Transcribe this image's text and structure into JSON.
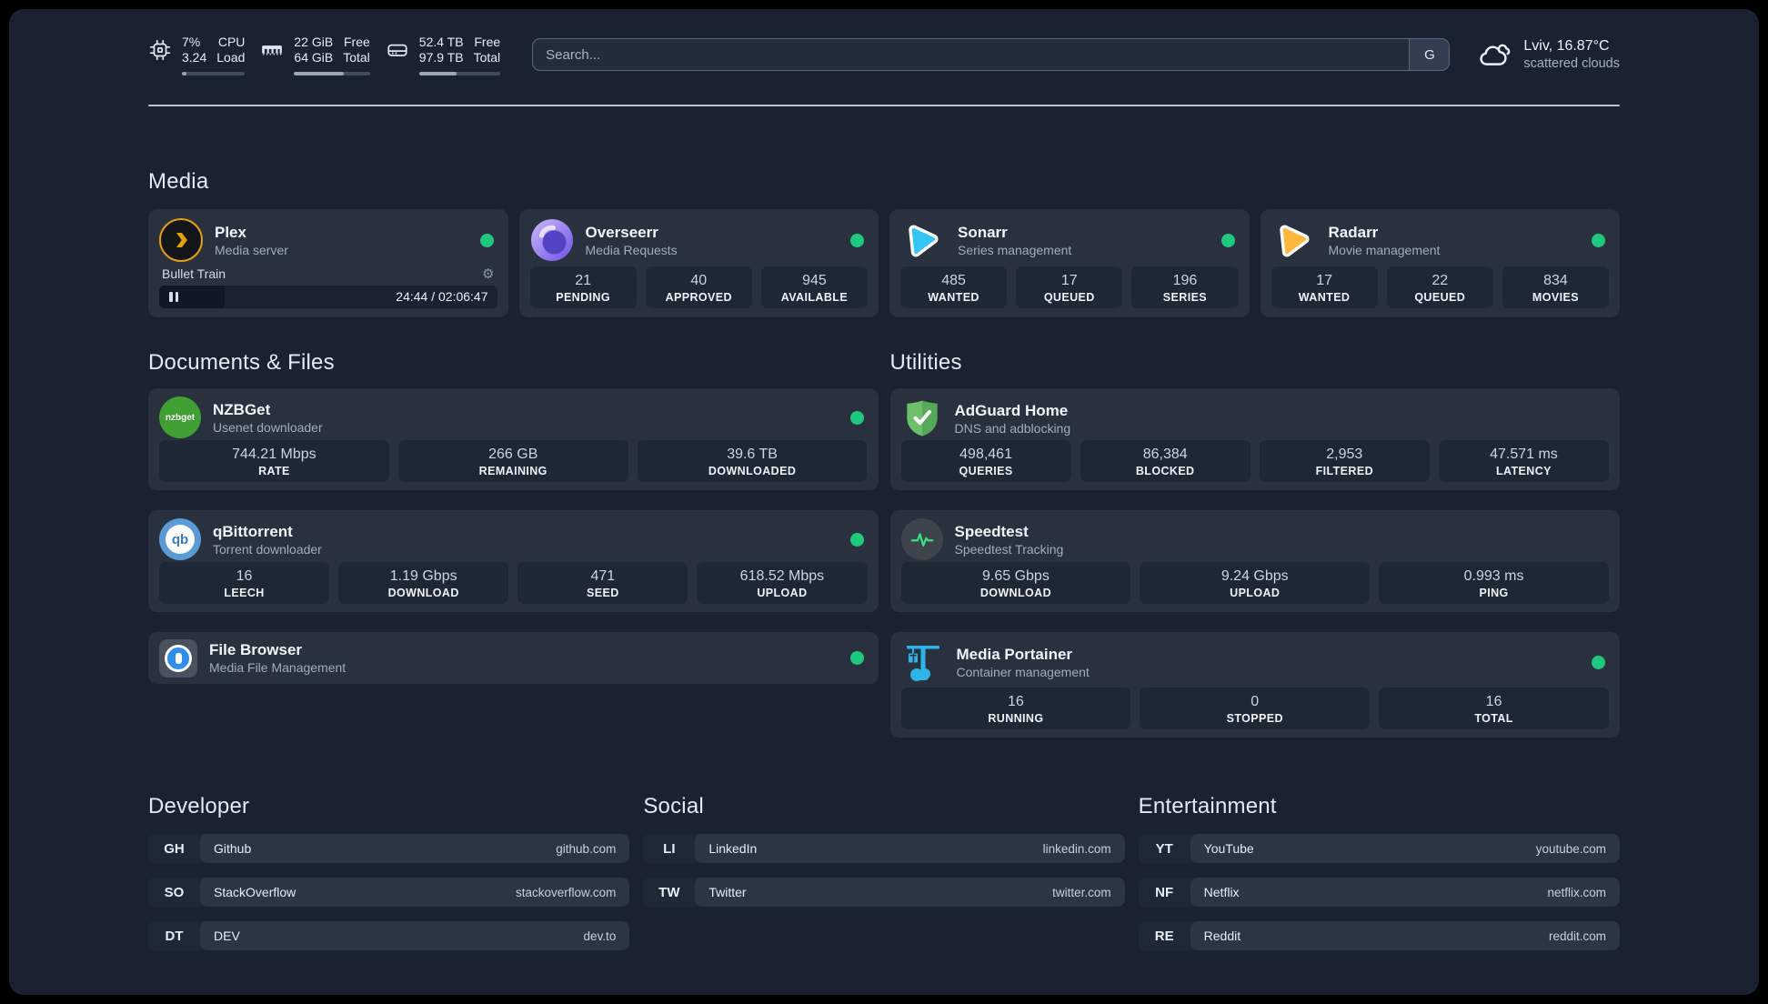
{
  "icons": {
    "gear": "⚙",
    "nzbget_label": "nzbget",
    "qbittorrent_label": "qb"
  },
  "colors": {
    "background": "#1a2232",
    "card": "#28313d",
    "stat_tile": "#1e2734",
    "status_online": "#1ec97e",
    "plex": "#e5a00d",
    "overseerr": "#6f52e8",
    "sonarr": "#35c5f4",
    "radarr": "#ffb83d",
    "nzbget": "#41a033",
    "qbittorrent": "#5b9bd5",
    "filebrowser": "#2f8fe8",
    "adguard": "#5fb463",
    "speedtest": "#34e27f",
    "portainer": "#2fb4ea"
  },
  "topbar": {
    "stats": [
      {
        "name": "cpu",
        "values": [
          "7%",
          "3.24"
        ],
        "labels": [
          "CPU",
          "Load"
        ],
        "percent": 7
      },
      {
        "name": "memory",
        "values": [
          "22 GiB",
          "64 GiB"
        ],
        "labels": [
          "Free",
          "Total"
        ],
        "percent": 66
      },
      {
        "name": "disk",
        "values": [
          "52.4 TB",
          "97.9 TB"
        ],
        "labels": [
          "Free",
          "Total"
        ],
        "percent": 46
      }
    ],
    "search": {
      "placeholder": "Search...",
      "button_label": "G"
    },
    "weather": {
      "title": "Lviv, 16.87°C",
      "subtitle": "scattered clouds"
    }
  },
  "sections": {
    "media": {
      "title": "Media",
      "plex": {
        "title": "Plex",
        "subtitle": "Media server",
        "status": "online",
        "now_playing": {
          "title": "Bullet Train",
          "time_display": "24:44 / 02:06:47",
          "progress_percent": 19.5,
          "state": "paused"
        }
      },
      "overseerr": {
        "title": "Overseerr",
        "subtitle": "Media Requests",
        "status": "online",
        "stats": [
          {
            "value": "21",
            "label": "PENDING"
          },
          {
            "value": "40",
            "label": "APPROVED"
          },
          {
            "value": "945",
            "label": "AVAILABLE"
          }
        ]
      },
      "sonarr": {
        "title": "Sonarr",
        "subtitle": "Series management",
        "status": "online",
        "stats": [
          {
            "value": "485",
            "label": "WANTED"
          },
          {
            "value": "17",
            "label": "QUEUED"
          },
          {
            "value": "196",
            "label": "SERIES"
          }
        ]
      },
      "radarr": {
        "title": "Radarr",
        "subtitle": "Movie management",
        "status": "online",
        "stats": [
          {
            "value": "17",
            "label": "WANTED"
          },
          {
            "value": "22",
            "label": "QUEUED"
          },
          {
            "value": "834",
            "label": "MOVIES"
          }
        ]
      }
    },
    "documents": {
      "title": "Documents & Files",
      "nzbget": {
        "title": "NZBGet",
        "subtitle": "Usenet downloader",
        "status": "online",
        "stats": [
          {
            "value": "744.21 Mbps",
            "label": "RATE"
          },
          {
            "value": "266 GB",
            "label": "REMAINING"
          },
          {
            "value": "39.6 TB",
            "label": "DOWNLOADED"
          }
        ]
      },
      "qbittorrent": {
        "title": "qBittorrent",
        "subtitle": "Torrent downloader",
        "status": "online",
        "stats": [
          {
            "value": "16",
            "label": "LEECH"
          },
          {
            "value": "1.19 Gbps",
            "label": "DOWNLOAD"
          },
          {
            "value": "471",
            "label": "SEED"
          },
          {
            "value": "618.52 Mbps",
            "label": "UPLOAD"
          }
        ]
      },
      "filebrowser": {
        "title": "File Browser",
        "subtitle": "Media File Management",
        "status": "online"
      }
    },
    "utilities": {
      "title": "Utilities",
      "adguard": {
        "title": "AdGuard Home",
        "subtitle": "DNS and adblocking",
        "stats": [
          {
            "value": "498,461",
            "label": "QUERIES"
          },
          {
            "value": "86,384",
            "label": "BLOCKED"
          },
          {
            "value": "2,953",
            "label": "FILTERED"
          },
          {
            "value": "47.571 ms",
            "label": "LATENCY"
          }
        ]
      },
      "speedtest": {
        "title": "Speedtest",
        "subtitle": "Speedtest Tracking",
        "stats": [
          {
            "value": "9.65 Gbps",
            "label": "DOWNLOAD"
          },
          {
            "value": "9.24 Gbps",
            "label": "UPLOAD"
          },
          {
            "value": "0.993 ms",
            "label": "PING"
          }
        ]
      },
      "portainer": {
        "title": "Media Portainer",
        "subtitle": "Container management",
        "status": "online",
        "stats": [
          {
            "value": "16",
            "label": "RUNNING"
          },
          {
            "value": "0",
            "label": "STOPPED"
          },
          {
            "value": "16",
            "label": "TOTAL"
          }
        ]
      }
    },
    "bookmarks": [
      {
        "title": "Developer",
        "items": [
          {
            "abbr": "GH",
            "name": "Github",
            "domain": "github.com"
          },
          {
            "abbr": "SO",
            "name": "StackOverflow",
            "domain": "stackoverflow.com"
          },
          {
            "abbr": "DT",
            "name": "DEV",
            "domain": "dev.to"
          }
        ]
      },
      {
        "title": "Social",
        "items": [
          {
            "abbr": "LI",
            "name": "LinkedIn",
            "domain": "linkedin.com"
          },
          {
            "abbr": "TW",
            "name": "Twitter",
            "domain": "twitter.com"
          }
        ]
      },
      {
        "title": "Entertainment",
        "items": [
          {
            "abbr": "YT",
            "name": "YouTube",
            "domain": "youtube.com"
          },
          {
            "abbr": "NF",
            "name": "Netflix",
            "domain": "netflix.com"
          },
          {
            "abbr": "RE",
            "name": "Reddit",
            "domain": "reddit.com"
          }
        ]
      }
    ]
  }
}
